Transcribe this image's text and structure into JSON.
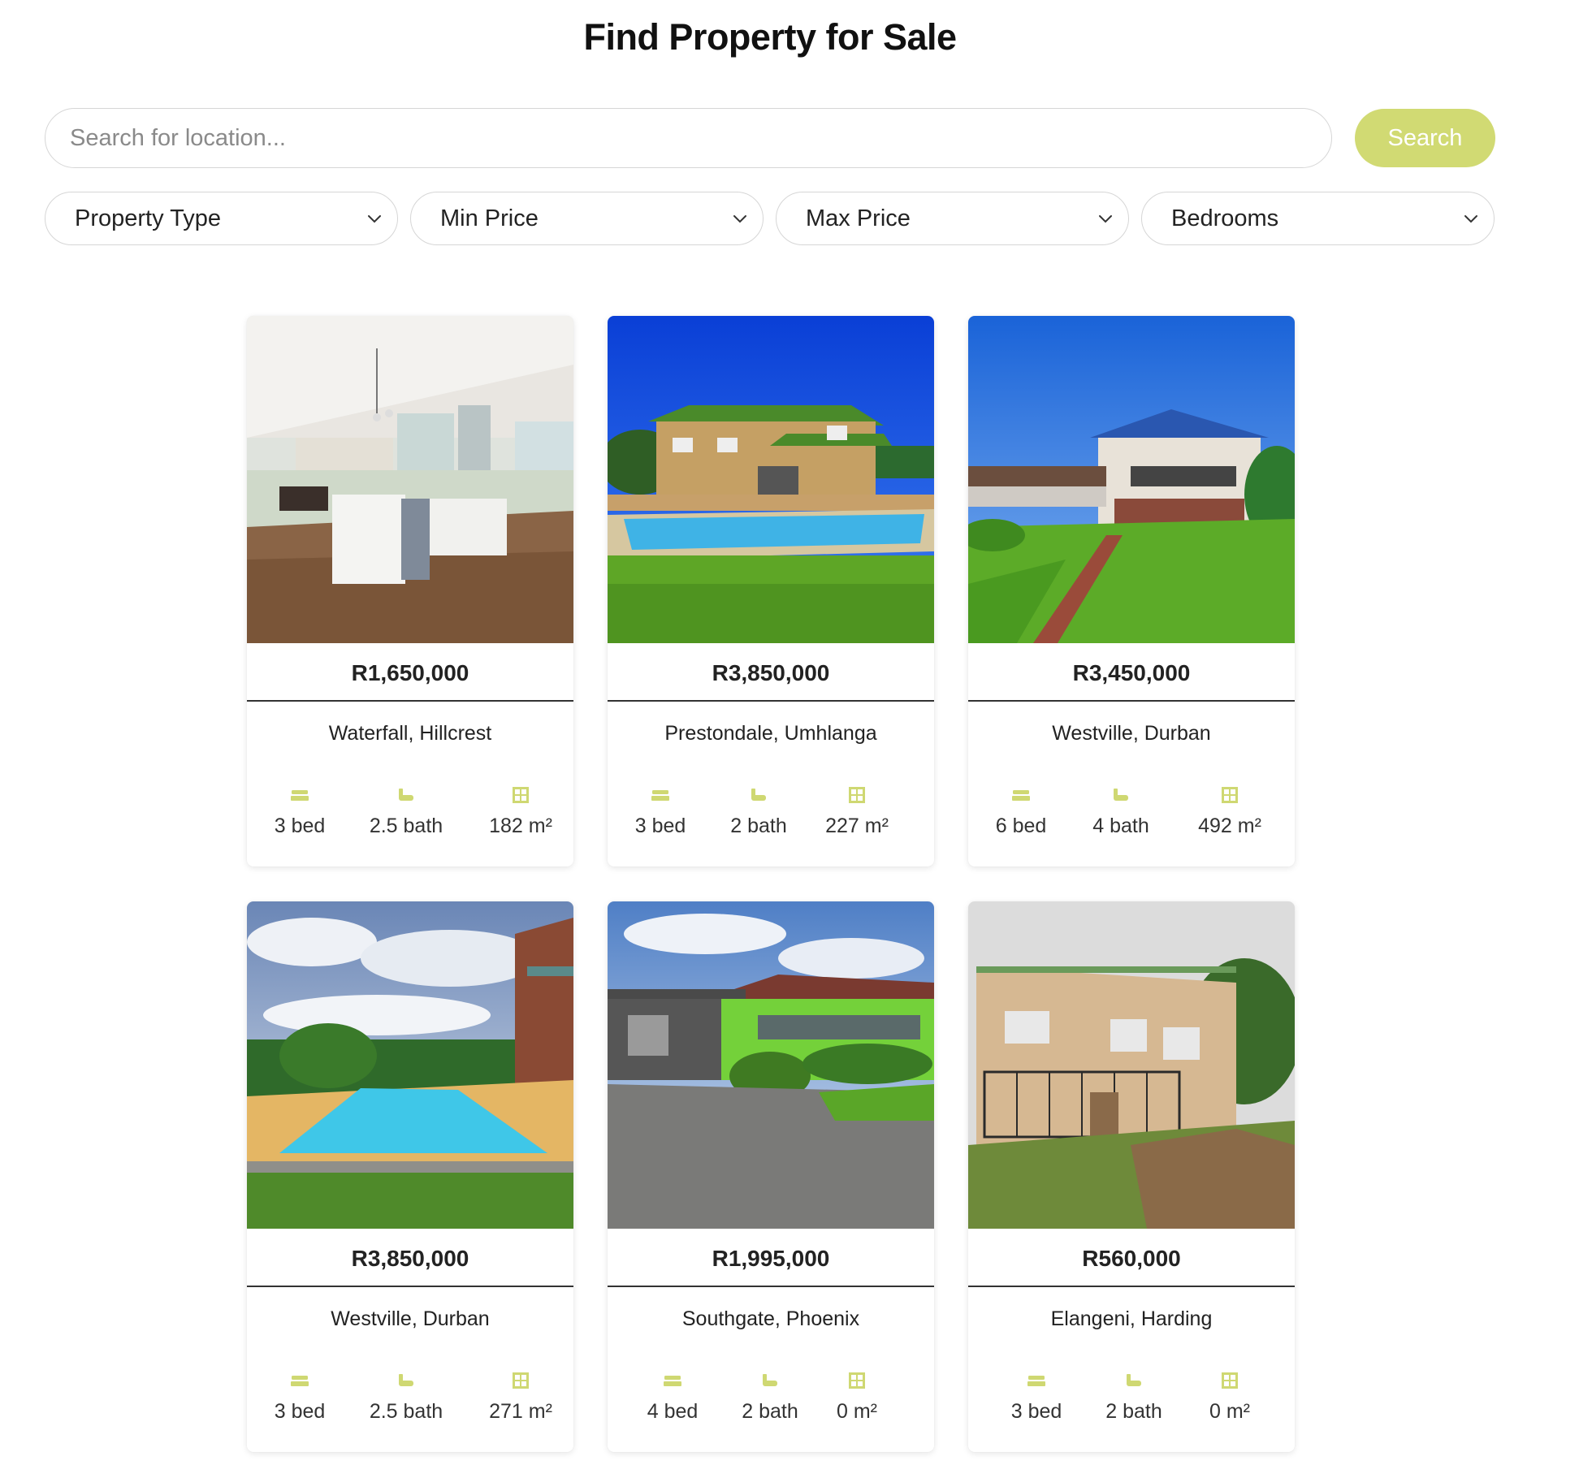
{
  "page": {
    "title": "Find Property for Sale"
  },
  "search": {
    "placeholder": "Search for location...",
    "value": "",
    "button_label": "Search"
  },
  "filters": [
    {
      "label": "Property Type"
    },
    {
      "label": "Min Price"
    },
    {
      "label": "Max Price"
    },
    {
      "label": "Bedrooms"
    }
  ],
  "colors": {
    "accent": "#d1da73",
    "icon": "#cfd872",
    "text": "#222222"
  },
  "listings": [
    {
      "price": "R1,650,000",
      "location": "Waterfall, Hillcrest",
      "beds": "3 bed",
      "baths": "2.5 bath",
      "size": "182 m²",
      "photo": "kitchen-interior-photo"
    },
    {
      "price": "R3,850,000",
      "location": "Prestondale, Umhlanga",
      "beds": "3 bed",
      "baths": "2 bath",
      "size": "227 m²",
      "photo": "house-with-pool-photo"
    },
    {
      "price": "R3,450,000",
      "location": "Westville, Durban",
      "beds": "6 bed",
      "baths": "4 bath",
      "size": "492 m²",
      "photo": "a-frame-house-photo"
    },
    {
      "price": "R3,850,000",
      "location": "Westville, Durban",
      "beds": "3 bed",
      "baths": "2.5 bath",
      "size": "271 m²",
      "photo": "pool-deck-photo"
    },
    {
      "price": "R1,995,000",
      "location": "Southgate, Phoenix",
      "beds": "4 bed",
      "baths": "2 bath",
      "size": "0 m²",
      "photo": "green-house-carport-photo"
    },
    {
      "price": "R560,000",
      "location": "Elangeni, Harding",
      "beds": "3 bed",
      "baths": "2 bath",
      "size": "0 m²",
      "photo": "two-storey-block-photo"
    }
  ]
}
